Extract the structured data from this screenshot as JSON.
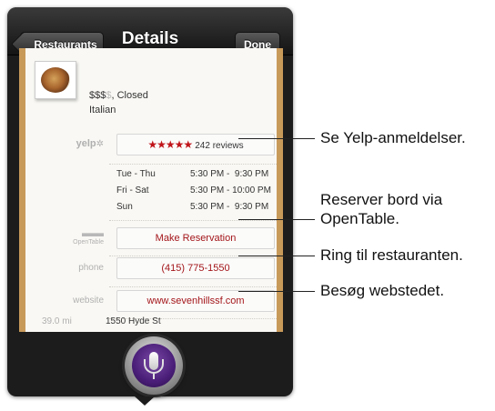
{
  "navbar": {
    "back_label": "Restaurants",
    "title": "Details",
    "done_label": "Done"
  },
  "restaurant": {
    "price": "$$$",
    "price_dim": "$",
    "status": ", Closed",
    "cuisine": "Italian",
    "yelp_label": "yelp",
    "stars": "★★★★★",
    "reviews": "242 reviews",
    "hours": [
      {
        "days": "Tue - Thu",
        "time": "5:30 PM -  9:30 PM"
      },
      {
        "days": "Fri - Sat",
        "time": "5:30 PM - 10:00 PM"
      },
      {
        "days": "Sun",
        "time": "5:30 PM -  9:30 PM"
      }
    ],
    "opentable_label": "OpenTable",
    "reservation_label": "Make Reservation",
    "phone_label": "phone",
    "phone": "(415) 775-1550",
    "website_label": "website",
    "website": "www.sevenhillssf.com",
    "distance": "39.0 mi",
    "address": "1550 Hyde St"
  },
  "callouts": {
    "yelp": "Se Yelp-anmeldelser.",
    "reserve_line1": "Reserver bord via",
    "reserve_line2": "OpenTable.",
    "phone": "Ring til restauranten.",
    "website": "Besøg webstedet."
  }
}
